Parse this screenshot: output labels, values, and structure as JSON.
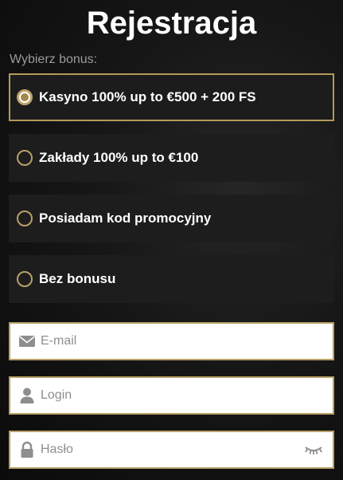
{
  "page": {
    "title": "Rejestracja"
  },
  "bonus": {
    "label": "Wybierz bonus:",
    "selected_index": 0,
    "options": [
      {
        "label": "Kasyno 100% up to €500 + 200 FS"
      },
      {
        "label": "Zakłady 100% up to €100"
      },
      {
        "label": "Posiadam kod promocyjny"
      },
      {
        "label": "Bez bonusu"
      }
    ]
  },
  "form": {
    "email": {
      "placeholder": "E-mail",
      "value": "",
      "icon": "envelope-icon"
    },
    "login": {
      "placeholder": "Login",
      "value": "",
      "icon": "user-icon"
    },
    "password": {
      "placeholder": "Hasło",
      "value": "",
      "icon": "lock-icon",
      "toggle_icon": "eye-closed-icon"
    }
  },
  "colors": {
    "accent_gold": "#b8a068",
    "panel": "#1d1d1d",
    "label_grey": "#9a9a9a"
  }
}
